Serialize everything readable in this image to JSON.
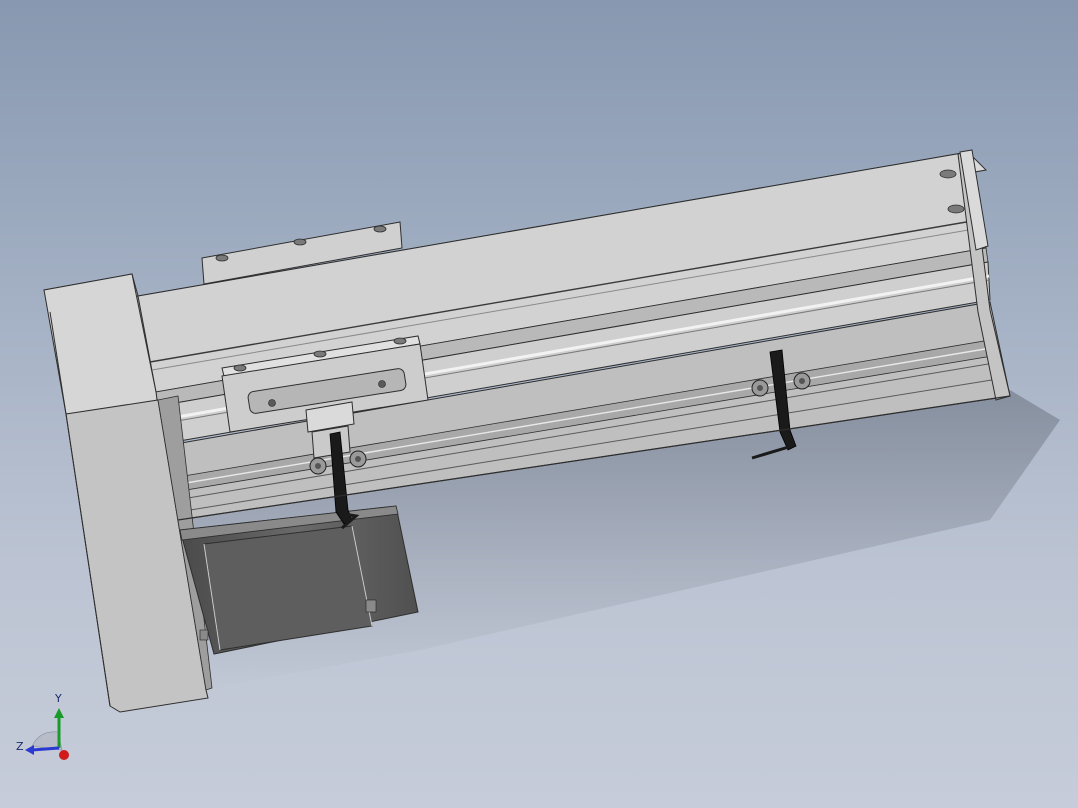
{
  "viewport": {
    "background_top": "#8798b0",
    "background_bottom": "#c6ccd9"
  },
  "model": {
    "body_color": "#d4d4d4",
    "shade_color": "#b4b4b4",
    "dark_color": "#6e6e6e",
    "edge_color": "#2e2e2e",
    "motor_color": "#5c5c5c",
    "wrench_color": "#1a1a1a"
  },
  "triad": {
    "x_axis_color": "#d11a1a",
    "y_axis_color": "#1a9a2a",
    "z_axis_color": "#2a3ad0",
    "y_label": "Y",
    "z_label": "Z"
  }
}
